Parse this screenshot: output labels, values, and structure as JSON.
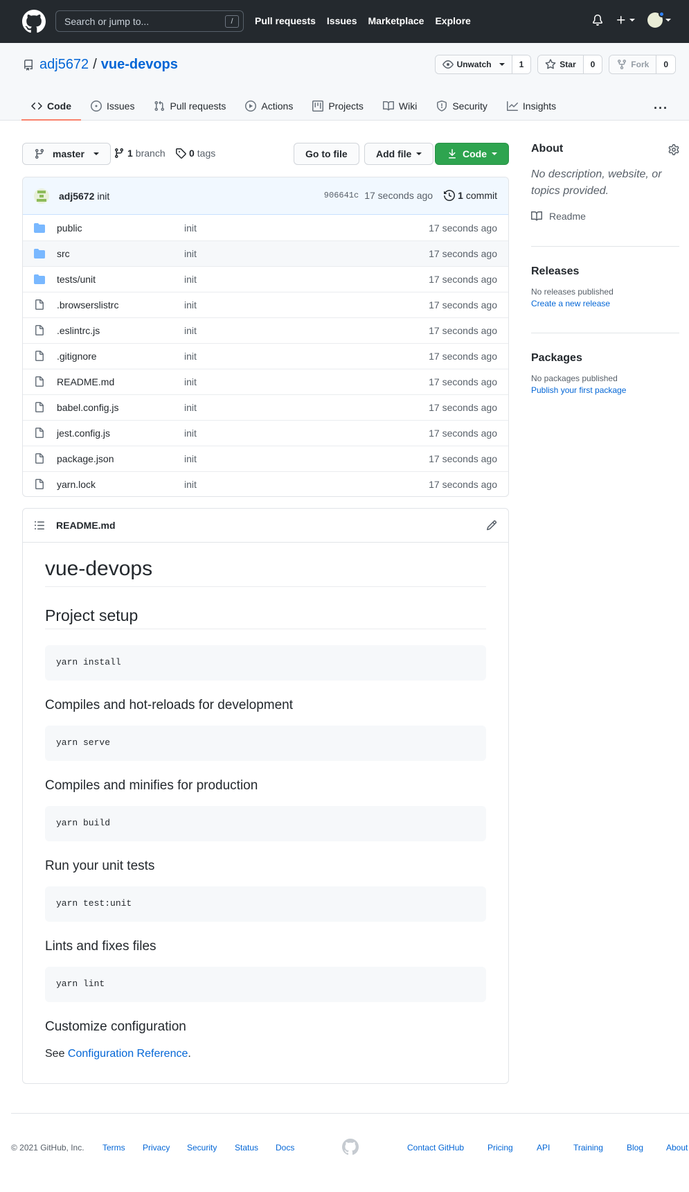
{
  "header": {
    "search_placeholder": "Search or jump to...",
    "search_key": "/",
    "nav": [
      "Pull requests",
      "Issues",
      "Marketplace",
      "Explore"
    ]
  },
  "repo": {
    "owner": "adj5672",
    "separator": "/",
    "name": "vue-devops",
    "watch_label": "Unwatch",
    "watch_count": "1",
    "star_label": "Star",
    "star_count": "0",
    "fork_label": "Fork",
    "fork_count": "0"
  },
  "tabs": [
    "Code",
    "Issues",
    "Pull requests",
    "Actions",
    "Projects",
    "Wiki",
    "Security",
    "Insights"
  ],
  "toolbar": {
    "branch": "master",
    "branch_count": "1",
    "branch_label": "branch",
    "tag_count": "0",
    "tag_label": "tags",
    "goto_label": "Go to file",
    "addfile_label": "Add file",
    "code_label": "Code"
  },
  "commit": {
    "author": "adj5672",
    "message": "init",
    "sha": "906641c",
    "time": "17 seconds ago",
    "count": "1",
    "count_label": "commit"
  },
  "files": [
    {
      "name": "public",
      "type": "folder",
      "message": "init",
      "age": "17 seconds ago"
    },
    {
      "name": "src",
      "type": "folder",
      "message": "init",
      "age": "17 seconds ago"
    },
    {
      "name": "tests/unit",
      "type": "folder",
      "message": "init",
      "age": "17 seconds ago"
    },
    {
      "name": ".browserslistrc",
      "type": "file",
      "message": "init",
      "age": "17 seconds ago"
    },
    {
      "name": ".eslintrc.js",
      "type": "file",
      "message": "init",
      "age": "17 seconds ago"
    },
    {
      "name": ".gitignore",
      "type": "file",
      "message": "init",
      "age": "17 seconds ago"
    },
    {
      "name": "README.md",
      "type": "file",
      "message": "init",
      "age": "17 seconds ago"
    },
    {
      "name": "babel.config.js",
      "type": "file",
      "message": "init",
      "age": "17 seconds ago"
    },
    {
      "name": "jest.config.js",
      "type": "file",
      "message": "init",
      "age": "17 seconds ago"
    },
    {
      "name": "package.json",
      "type": "file",
      "message": "init",
      "age": "17 seconds ago"
    },
    {
      "name": "yarn.lock",
      "type": "file",
      "message": "init",
      "age": "17 seconds ago"
    }
  ],
  "readme": {
    "filename": "README.md",
    "title": "vue-devops",
    "setup_heading": "Project setup",
    "setup_cmd": "yarn install",
    "dev_heading": "Compiles and hot-reloads for development",
    "dev_cmd": "yarn serve",
    "prod_heading": "Compiles and minifies for production",
    "prod_cmd": "yarn build",
    "test_heading": "Run your unit tests",
    "test_cmd": "yarn test:unit",
    "lint_heading": "Lints and fixes files",
    "lint_cmd": "yarn lint",
    "config_heading": "Customize configuration",
    "config_text": "See",
    "config_link": "Configuration Reference",
    "config_period": "."
  },
  "sidebar": {
    "about_title": "About",
    "about_desc": "No description, website, or topics provided.",
    "readme_label": "Readme",
    "releases_title": "Releases",
    "releases_text": "No releases published",
    "releases_link": "Create a new release",
    "packages_title": "Packages",
    "packages_text": "No packages published",
    "packages_link": "Publish your first package"
  },
  "footer": {
    "copyright": "© 2021 GitHub, Inc.",
    "left_links": [
      "Terms",
      "Privacy",
      "Security",
      "Status",
      "Docs"
    ],
    "right_links": [
      "Contact GitHub",
      "Pricing",
      "API",
      "Training",
      "Blog",
      "About"
    ]
  },
  "colors": {
    "header_bg": "#24292e",
    "accent_link": "#0366d6",
    "code_button": "#2ea44f",
    "active_tab_underline": "#f9826c",
    "folder_icon": "#79b8ff"
  }
}
